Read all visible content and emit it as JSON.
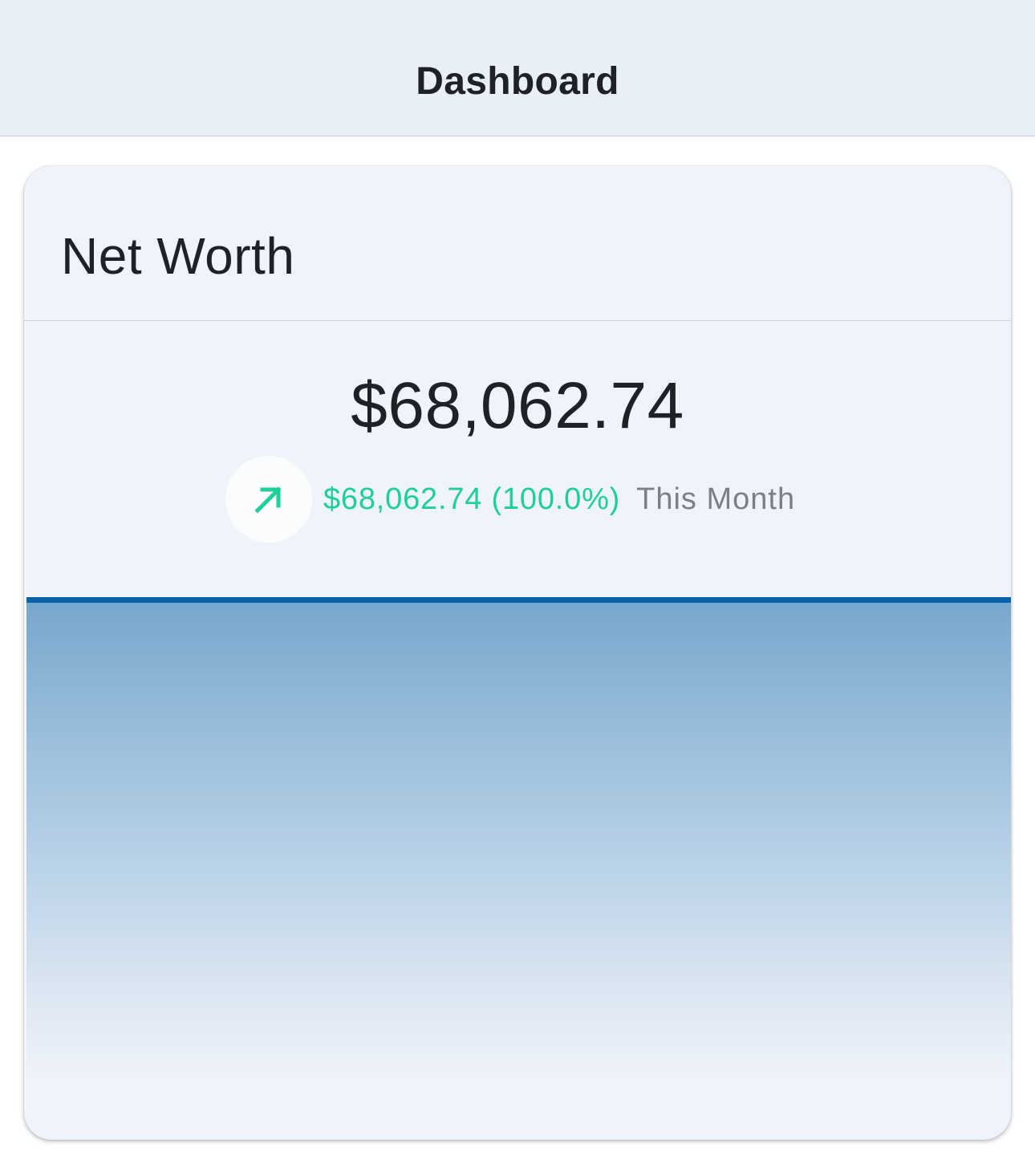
{
  "header": {
    "title": "Dashboard"
  },
  "net_worth_card": {
    "title": "Net Worth",
    "amount": "$68,062.74",
    "change": {
      "value": "$68,062.74 (100.0%)",
      "period": "This Month",
      "direction_icon": "arrow-up-right-icon",
      "color": "#1fcf9a"
    },
    "chart": {
      "line_color": "#0462a8",
      "fill_color": "#76a6cc"
    }
  }
}
